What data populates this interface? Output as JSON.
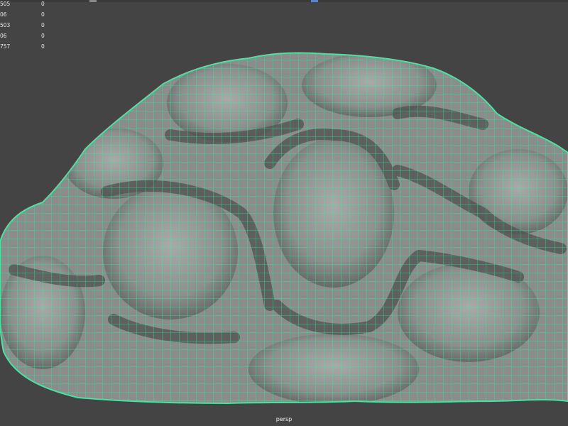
{
  "viewport": {
    "camera_label": "persp",
    "background_color": "#444444",
    "mesh_fill_color": "#8c8c8c",
    "wireframe_color": "#4de0a0"
  },
  "hud": {
    "rows": [
      {
        "label": "505",
        "value": "0"
      },
      {
        "label": "06",
        "value": "0"
      },
      {
        "label": "503",
        "value": "0"
      },
      {
        "label": "06",
        "value": "0"
      },
      {
        "label": "757",
        "value": "0"
      }
    ]
  }
}
